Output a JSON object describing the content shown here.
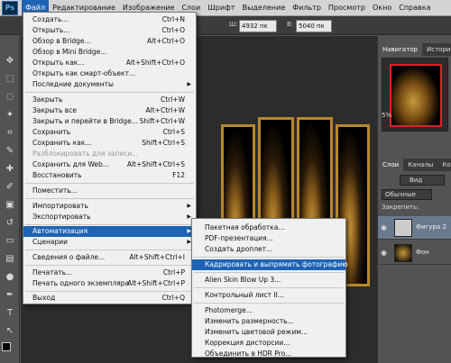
{
  "app": {
    "logo": "Ps"
  },
  "menubar": {
    "items": [
      "Файл",
      "Редактирование",
      "Изображение",
      "Слои",
      "Шрифт",
      "Выделение",
      "Фильтр",
      "Просмотр",
      "Окно",
      "Справка"
    ]
  },
  "options": {
    "w_label": "Ш:",
    "w_value": "4932 пк",
    "h_label": "В:",
    "h_value": "5040 пк"
  },
  "file_menu": [
    {
      "label": "Создать...",
      "shortcut": "Ctrl+N"
    },
    {
      "label": "Открыть...",
      "shortcut": "Ctrl+O"
    },
    {
      "label": "Обзор в Bridge...",
      "shortcut": "Alt+Ctrl+O"
    },
    {
      "label": "Обзор в Mini Bridge...",
      "shortcut": ""
    },
    {
      "label": "Открыть как...",
      "shortcut": "Alt+Shift+Ctrl+O"
    },
    {
      "label": "Открыть как смарт-объект...",
      "shortcut": ""
    },
    {
      "label": "Последние документы",
      "shortcut": ""
    },
    {
      "label": "Закрыть",
      "shortcut": "Ctrl+W"
    },
    {
      "label": "Закрыть все",
      "shortcut": "Alt+Ctrl+W"
    },
    {
      "label": "Закрыть и перейти в Bridge...",
      "shortcut": "Shift+Ctrl+W"
    },
    {
      "label": "Сохранить",
      "shortcut": "Ctrl+S"
    },
    {
      "label": "Сохранить как...",
      "shortcut": "Shift+Ctrl+S"
    },
    {
      "label": "Разблокировать для записи...",
      "shortcut": ""
    },
    {
      "label": "Сохранить для Web...",
      "shortcut": "Alt+Shift+Ctrl+S"
    },
    {
      "label": "Восстановить",
      "shortcut": "F12"
    },
    {
      "label": "Поместить...",
      "shortcut": ""
    },
    {
      "label": "Импортировать",
      "shortcut": ""
    },
    {
      "label": "Экспортировать",
      "shortcut": ""
    },
    {
      "label": "Автоматизация",
      "shortcut": ""
    },
    {
      "label": "Сценарии",
      "shortcut": ""
    },
    {
      "label": "Сведения о файле...",
      "shortcut": "Alt+Shift+Ctrl+I"
    },
    {
      "label": "Печатать...",
      "shortcut": "Ctrl+P"
    },
    {
      "label": "Печать одного экземпляра",
      "shortcut": "Alt+Shift+Ctrl+P"
    },
    {
      "label": "Выход",
      "shortcut": "Ctrl+Q"
    }
  ],
  "automation_menu": [
    "Пакетная обработка...",
    "PDF-презентация...",
    "Создать дроплет...",
    "Кадрировать и выпрямить фотографию",
    "Alien Skin Blow Up 3...",
    "Контрольный лист II...",
    "Photomerge...",
    "Изменить размерность...",
    "Изменить цветовой режим...",
    "Коррекция дисторсии...",
    "Объединить в HDR Pro..."
  ],
  "panels": {
    "nav_tabs": [
      "Навигатор",
      "История"
    ],
    "zoom": "5%",
    "layer_tabs": [
      "Слои",
      "Каналы",
      "Контуры"
    ],
    "kind": "Вид",
    "blend": "Обычные",
    "lock_label": "Закрепить:",
    "layers": [
      "Фигура 2",
      "Фон"
    ]
  }
}
